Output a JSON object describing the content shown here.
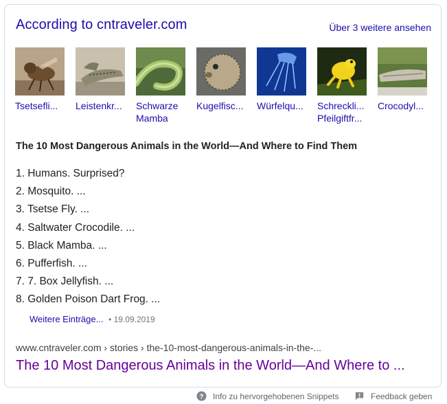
{
  "header": {
    "title": "According to cntraveler.com",
    "more_link": "Über 3 weitere ansehen"
  },
  "thumbnails": [
    {
      "label": "Tsetsefli...",
      "icon": "tsetse-fly-photo"
    },
    {
      "label": "Leistenkr...",
      "icon": "saltwater-crocodile-photo"
    },
    {
      "label": "Schwarze Mamba",
      "icon": "black-mamba-photo"
    },
    {
      "label": "Kugelfisc...",
      "icon": "pufferfish-photo"
    },
    {
      "label": "Würfelqu...",
      "icon": "box-jellyfish-photo"
    },
    {
      "label": "Schreckli... Pfeilgiftfr...",
      "icon": "poison-dart-frog-photo"
    },
    {
      "label": "Crocodyl...",
      "icon": "crocodile-photo"
    }
  ],
  "snippet": {
    "title": "The 10 Most Dangerous Animals in the World—And Where to Find Them",
    "items": [
      "1. Humans. Surprised?",
      "2. Mosquito. ...",
      "3. Tsetse Fly. ...",
      "4. Saltwater Crocodile. ...",
      "5. Black Mamba. ...",
      "6. Pufferfish. ...",
      "7. 7. Box Jellyfish. ...",
      "8. Golden Poison Dart Frog. ..."
    ],
    "more_entries": "Weitere Einträge...",
    "date": "19.09.2019"
  },
  "result": {
    "cite": "www.cntraveler.com › stories › the-10-most-dangerous-animals-in-the-...",
    "title": "The 10 Most Dangerous Animals in the World—And Where to ..."
  },
  "footer": {
    "info": "Info zu hervorgehobenen Snippets",
    "feedback": "Feedback geben"
  },
  "colors": {
    "link": "#1a0dab",
    "visited": "#660099",
    "border": "#dadce0"
  }
}
